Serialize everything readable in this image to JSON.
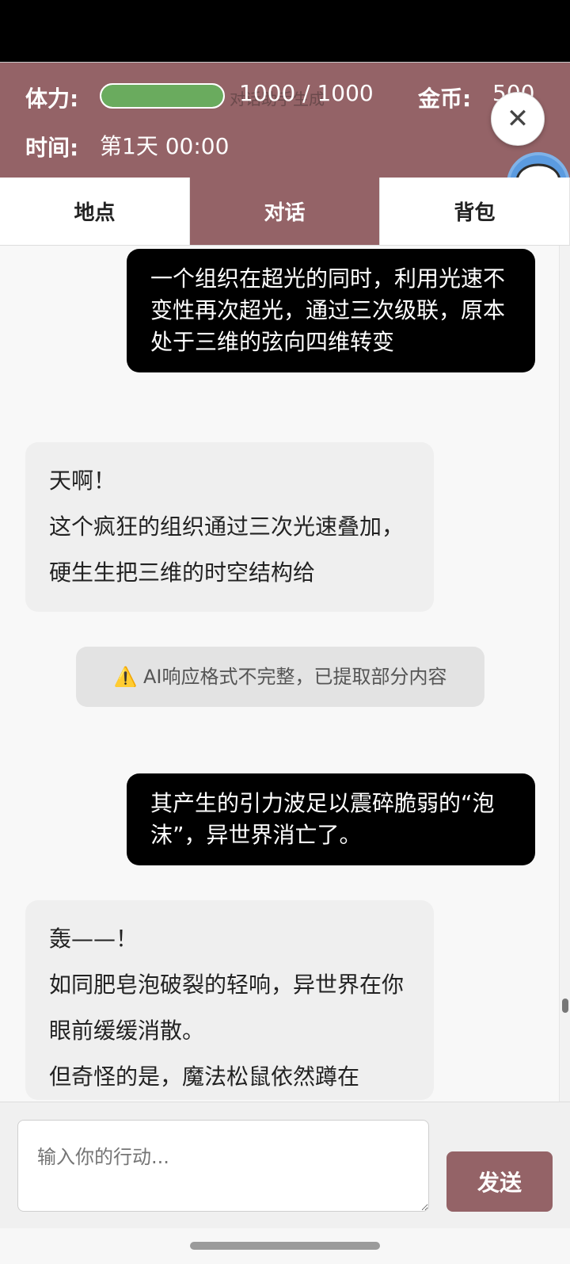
{
  "header": {
    "stamina_label": "体力:",
    "stamina_value": "1000 / 1000",
    "stamina_fraction": 1.0,
    "bar_overlay_text": "对话助手生成",
    "gold_label": "金币:",
    "gold_value": "500",
    "time_label": "时间:",
    "time_value": "第1天  00:00",
    "close_label": "✕"
  },
  "tabs": [
    {
      "label": "地点",
      "active": false
    },
    {
      "label": "对话",
      "active": true
    },
    {
      "label": "背包",
      "active": false
    }
  ],
  "messages": {
    "user_1": "一个组织在超光的同时，利用光速不变性再次超光，通过三次级联，原本处于三维的弦向四维转变",
    "ai_1_line1": "天啊！",
    "ai_1_line2": "这个疯狂的组织通过三次光速叠加，硬生生把三维的时空结构给",
    "system_1": "⚠️ AI响应格式不完整，已提取部分内容",
    "user_2": "其产生的引力波足以震碎脆弱的“泡沫”，异世界消亡了。",
    "ai_2_line1": "轰——！",
    "ai_2_line2": "如同肥皂泡破裂的轻响，异世界在你眼前缓缓消散。",
    "ai_2_line3": "但奇怪的是，魔法松鼠依然蹲在"
  },
  "input": {
    "placeholder": "输入你的行动...",
    "send_label": "发送"
  },
  "colors": {
    "accent": "#946367",
    "stamina_green": "#6aab5e",
    "chat_button": "#5b9be0"
  }
}
